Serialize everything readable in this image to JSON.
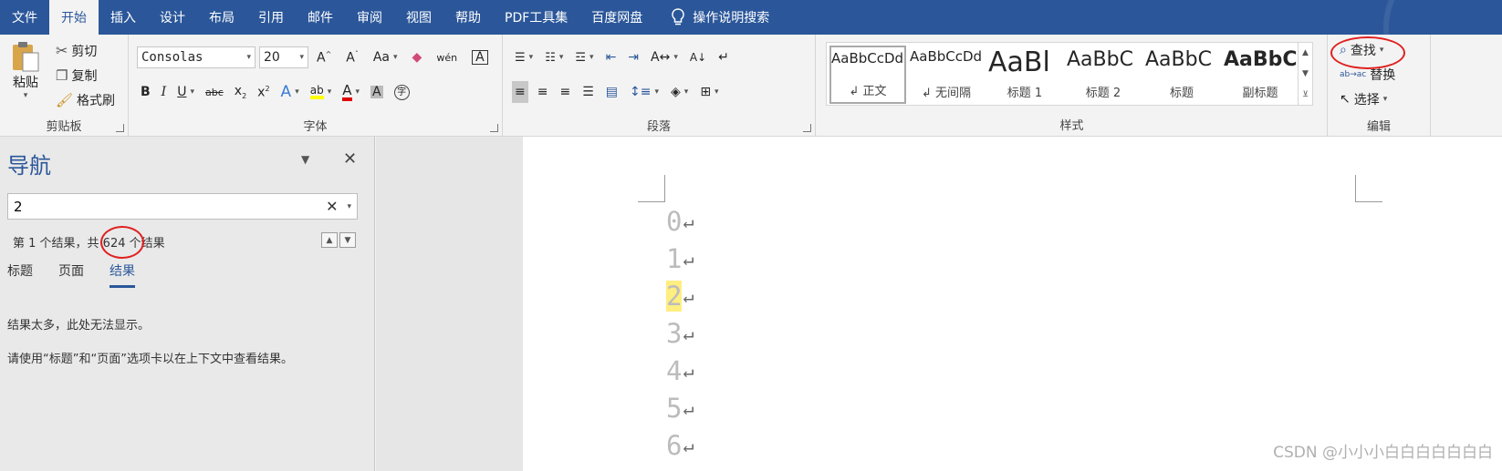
{
  "menu": {
    "tabs": [
      "文件",
      "开始",
      "插入",
      "设计",
      "布局",
      "引用",
      "邮件",
      "审阅",
      "视图",
      "帮助",
      "PDF工具集",
      "百度网盘"
    ],
    "active_index": 1,
    "tell_me": "操作说明搜索"
  },
  "clipboard": {
    "paste": "粘贴",
    "cut": "剪切",
    "copy": "复制",
    "format_painter": "格式刷",
    "label": "剪贴板"
  },
  "font": {
    "name": "Consolas",
    "size": "20",
    "label": "字体"
  },
  "paragraph": {
    "label": "段落"
  },
  "styles": {
    "label": "样式",
    "items": [
      {
        "sample": "AaBbCcDd",
        "name": "↲ 正文"
      },
      {
        "sample": "AaBbCcDd",
        "name": "↲ 无间隔"
      },
      {
        "sample": "AaBl",
        "name": "标题 1"
      },
      {
        "sample": "AaBbC",
        "name": "标题 2"
      },
      {
        "sample": "AaBbC",
        "name": "标题"
      },
      {
        "sample": "AaBbC",
        "name": "副标题"
      }
    ]
  },
  "editing": {
    "find": "查找",
    "replace": "替换",
    "select": "选择",
    "label": "编辑"
  },
  "nav": {
    "title": "导航",
    "search_value": "2",
    "status": "第 1 个结果，共 624 个结果",
    "tabs": [
      "标题",
      "页面",
      "结果"
    ],
    "message1": "结果太多，此处无法显示。",
    "message2": "请使用“标题”和“页面”选项卡以在上下文中查看结果。"
  },
  "document": {
    "lines": [
      "0",
      "1",
      "2",
      "3",
      "4",
      "5",
      "6"
    ],
    "highlight_index": 2
  },
  "watermark": "CSDN @小小小白白白白白白白"
}
